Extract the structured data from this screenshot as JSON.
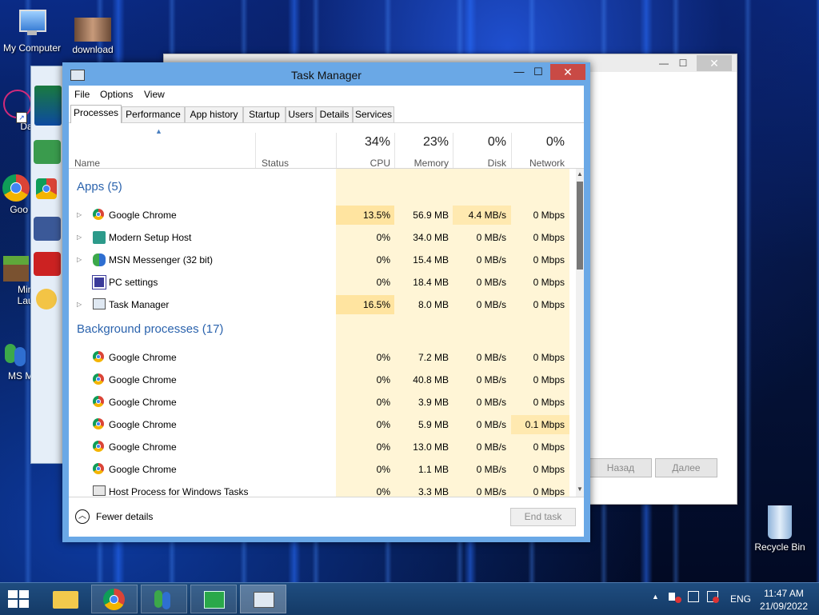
{
  "desktop": {
    "icons": [
      {
        "label": "My Computer"
      },
      {
        "label": "download"
      },
      {
        "label": "DataW"
      },
      {
        "label": "Goo Chr"
      },
      {
        "label": "Mine Laun"
      },
      {
        "label": "MS Mess"
      },
      {
        "label": "Recycle Bin"
      }
    ]
  },
  "wizard": {
    "back_label": "Назад",
    "next_label": "Далее"
  },
  "task_manager": {
    "title": "Task Manager",
    "menu": [
      "File",
      "Options",
      "View"
    ],
    "tabs": [
      "Processes",
      "Performance",
      "App history",
      "Startup",
      "Users",
      "Details",
      "Services"
    ],
    "active_tab": "Processes",
    "columns": {
      "name": "Name",
      "status": "Status",
      "cpu": {
        "pct": "34%",
        "label": "CPU"
      },
      "memory": {
        "pct": "23%",
        "label": "Memory"
      },
      "disk": {
        "pct": "0%",
        "label": "Disk"
      },
      "network": {
        "pct": "0%",
        "label": "Network"
      }
    },
    "apps_group": "Apps (5)",
    "apps": [
      {
        "name": "Google Chrome",
        "icon": "chrome-icon",
        "cpu": "13.5%",
        "memory": "56.9 MB",
        "disk": "4.4 MB/s",
        "network": "0 Mbps"
      },
      {
        "name": "Modern Setup Host",
        "icon": "setup-host-icon",
        "cpu": "0%",
        "memory": "34.0 MB",
        "disk": "0 MB/s",
        "network": "0 Mbps"
      },
      {
        "name": "MSN Messenger (32 bit)",
        "icon": "msn-icon",
        "cpu": "0%",
        "memory": "15.4 MB",
        "disk": "0 MB/s",
        "network": "0 Mbps"
      },
      {
        "name": "PC settings",
        "icon": "gear-icon",
        "cpu": "0%",
        "memory": "18.4 MB",
        "disk": "0 MB/s",
        "network": "0 Mbps"
      },
      {
        "name": "Task Manager",
        "icon": "task-manager-icon",
        "cpu": "16.5%",
        "memory": "8.0 MB",
        "disk": "0 MB/s",
        "network": "0 Mbps"
      }
    ],
    "background_group": "Background processes (17)",
    "background": [
      {
        "name": "Google Chrome",
        "icon": "chrome-icon",
        "cpu": "0%",
        "memory": "7.2 MB",
        "disk": "0 MB/s",
        "network": "0 Mbps"
      },
      {
        "name": "Google Chrome",
        "icon": "chrome-icon",
        "cpu": "0%",
        "memory": "40.8 MB",
        "disk": "0 MB/s",
        "network": "0 Mbps"
      },
      {
        "name": "Google Chrome",
        "icon": "chrome-icon",
        "cpu": "0%",
        "memory": "3.9 MB",
        "disk": "0 MB/s",
        "network": "0 Mbps"
      },
      {
        "name": "Google Chrome",
        "icon": "chrome-icon",
        "cpu": "0%",
        "memory": "5.9 MB",
        "disk": "0 MB/s",
        "network": "0.1 Mbps"
      },
      {
        "name": "Google Chrome",
        "icon": "chrome-icon",
        "cpu": "0%",
        "memory": "13.0 MB",
        "disk": "0 MB/s",
        "network": "0 Mbps"
      },
      {
        "name": "Google Chrome",
        "icon": "chrome-icon",
        "cpu": "0%",
        "memory": "1.1 MB",
        "disk": "0 MB/s",
        "network": "0 Mbps"
      },
      {
        "name": "Host Process for Windows Tasks",
        "icon": "host-process-icon",
        "cpu": "0%",
        "memory": "3.3 MB",
        "disk": "0 MB/s",
        "network": "0 Mbps"
      }
    ],
    "fewer_details": "Fewer details",
    "end_task": "End task"
  },
  "taskbar": {
    "language": "ENG",
    "time": "11:47 AM",
    "date": "21/09/2022"
  }
}
